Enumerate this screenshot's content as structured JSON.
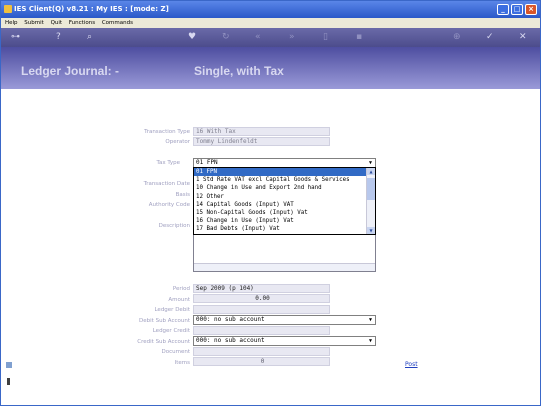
{
  "window": {
    "title": "IES Client(Q) v8.21 : My IES :      [mode: Z]",
    "min": "_",
    "max": "□",
    "close": "×"
  },
  "menu": [
    "Help",
    "Submit",
    "Quit",
    "Functions",
    "Commands"
  ],
  "toolbar": {
    "icons": [
      "key-icon",
      "help-icon",
      "search-icon",
      "heart-icon",
      "refresh-icon",
      "rewind-icon",
      "forward-icon",
      "document-icon",
      "trash-icon",
      "plus-icon",
      "check-icon",
      "close-icon"
    ]
  },
  "header": {
    "left": "Ledger Journal: -",
    "right": "Single, with Tax"
  },
  "form": {
    "transaction_type_label": "Transaction Type",
    "transaction_type": "16 With Tax",
    "operator_label": "Operator",
    "operator": "Tommy Lindenfeldt",
    "tax_type_label": "Tax Type",
    "tax_type": "01 FPN",
    "transaction_date_label": "Transaction Date",
    "basis_label": "Basis",
    "authority_code_label": "Authority Code",
    "description_label": "Description",
    "period_label": "Period",
    "period": "Sep 2009 (p 104)",
    "amount_label": "Amount",
    "amount": "0.00",
    "ledger_debit_label": "Ledger Debit",
    "debit_sub_account_label": "Debit Sub Account",
    "debit_sub_account": "000: no sub account",
    "ledger_credit_label": "Ledger Credit",
    "credit_sub_account_label": "Credit Sub Account",
    "credit_sub_account": "000: no sub account",
    "document_label": "Document",
    "items_label": "Items",
    "items": "0"
  },
  "tax_options": [
    "01 FPN",
    "1 Std Rate VAT excl Capital Goods & Services",
    "10 Change in Use and Export 2nd hand",
    "12 Other",
    "14 Capital Goods (Input) VAT",
    "15 Non-Capital Goods (Input) Vat",
    "16 Change in Use (Input) Vat",
    "17 Bad Debts (Input) Vat"
  ],
  "post_link": "Post"
}
